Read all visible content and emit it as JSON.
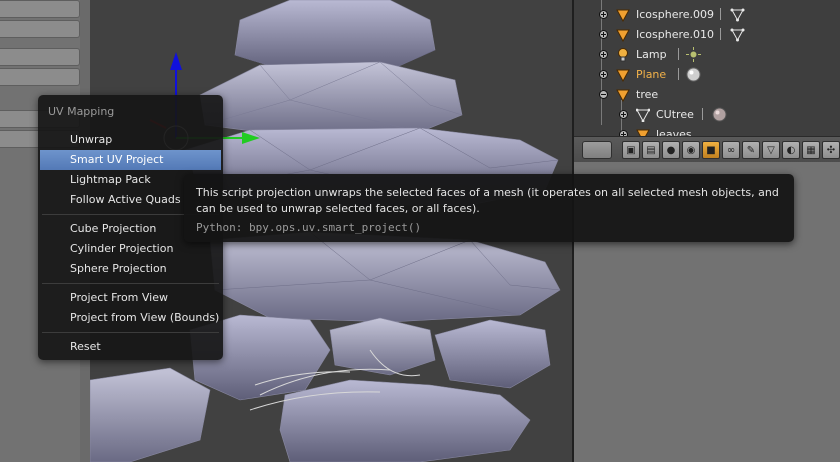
{
  "menu": {
    "title": "UV Mapping",
    "items": [
      {
        "label": "Unwrap",
        "active": false
      },
      {
        "label": "Smart UV Project",
        "active": true
      },
      {
        "label": "Lightmap Pack",
        "active": false
      },
      {
        "label": "Follow Active Quads",
        "active": false
      },
      {
        "label": "Cube Projection",
        "active": false
      },
      {
        "label": "Cylinder Projection",
        "active": false
      },
      {
        "label": "Sphere Projection",
        "active": false
      },
      {
        "label": "Project From View",
        "active": false
      },
      {
        "label": "Project from View (Bounds)",
        "active": false
      },
      {
        "label": "Reset",
        "active": false
      }
    ]
  },
  "tooltip": {
    "description": "This script projection unwraps the selected faces of a mesh (it operates on all selected mesh objects, and can be used to unwrap selected faces, or all faces).",
    "python": "Python: bpy.ops.uv.smart_project()"
  },
  "outliner": {
    "rows": [
      {
        "label": "Icosphere.009",
        "icon": "mesh-object-icon",
        "data_icon": "mesh-data-icon"
      },
      {
        "label": "Icosphere.010",
        "icon": "mesh-object-icon",
        "data_icon": "mesh-data-icon"
      },
      {
        "label": "Lamp",
        "icon": "lamp-object-icon",
        "data_icon": "lamp-data-icon"
      },
      {
        "label": "Plane",
        "icon": "mesh-object-icon",
        "data_icon": "material-icon"
      },
      {
        "label": "tree",
        "icon": "mesh-object-icon",
        "data_icon": ""
      },
      {
        "label": "CUtree",
        "icon": "curve-data-icon",
        "data_icon": "material-icon"
      },
      {
        "label": "leaves",
        "icon": "mesh-object-icon",
        "data_icon": "mesh-data-icon"
      }
    ]
  },
  "properties_tabs": [
    "render-icon",
    "render-layers-icon",
    "scene-icon",
    "world-icon",
    "object-icon",
    "constraints-icon",
    "modifiers-icon",
    "mesh-data-icon",
    "material-icon",
    "texture-icon",
    "particles-icon"
  ],
  "colors": {
    "menu_highlight": "#5b82c0",
    "object_orange": "#f0a030",
    "axis_x": "#22cc22",
    "axis_z": "#1010dd",
    "axis_red": "#cc2020"
  }
}
